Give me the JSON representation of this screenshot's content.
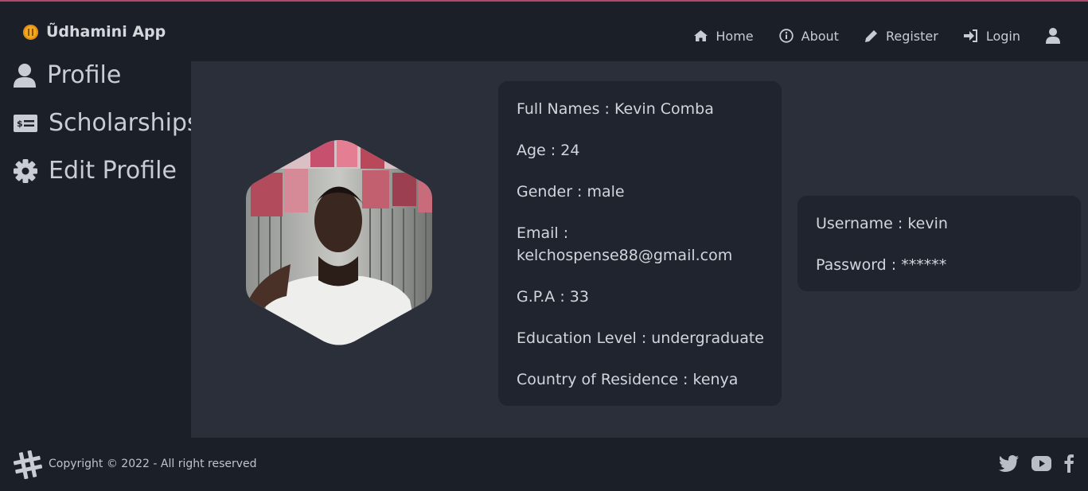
{
  "brand": {
    "name": "Ũdhamini App",
    "logo_icon": "coin-icon",
    "logo_color": "#f2a91d"
  },
  "nav": {
    "items": [
      {
        "label": "Home",
        "icon": "home-icon"
      },
      {
        "label": "About",
        "icon": "info-icon"
      },
      {
        "label": "Register",
        "icon": "pencil-icon"
      },
      {
        "label": "Login",
        "icon": "login-icon"
      }
    ],
    "user_icon": "user-icon"
  },
  "sidebar": {
    "items": [
      {
        "label": "Profile",
        "icon": "user-icon"
      },
      {
        "label": "Scholarships",
        "icon": "money-bill-icon"
      },
      {
        "label": "Edit Profile",
        "icon": "gear-icon"
      }
    ]
  },
  "profile": {
    "full_names": "Full Names : Kevin Comba",
    "age": "Age : 24",
    "gender": "Gender : male",
    "email_label": "Email :",
    "email_value": "kelchospense88@gmail.com",
    "gpa": "G.P.A : 33",
    "education_level": "Education Level : undergraduate",
    "country": "Country of Residence : kenya"
  },
  "credentials": {
    "username": "Username : kevin",
    "password": "Password : ******"
  },
  "footer": {
    "copyright": "Copyright © 2022 - All right reserved",
    "logo_icon": "hashtag-icon",
    "socials": [
      "twitter-icon",
      "youtube-icon",
      "facebook-icon"
    ]
  },
  "colors": {
    "accent_line": "#b0486e",
    "background": "#1b1f27",
    "main": "#2a2f3a",
    "card": "#20242e"
  }
}
